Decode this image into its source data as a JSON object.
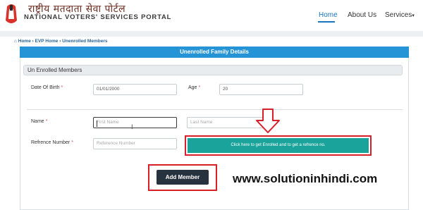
{
  "header": {
    "logo_hindi": "राष्ट्रीय मतदाता सेवा पोर्टल",
    "logo_english": "NATIONAL VOTERS' SERVICES PORTAL",
    "nav": {
      "home": "Home",
      "about": "About Us",
      "services": "Services",
      "services_caret": "▾"
    }
  },
  "breadcrumb": {
    "home_icon": "home-icon",
    "items": [
      "Home",
      "EVP Home",
      "Unenrolled Members"
    ],
    "separator": "›"
  },
  "panel": {
    "title": "Unenrolled Family Details",
    "section_title": "Un Enrolled Members"
  },
  "form": {
    "dob_label": "Date Of Birth",
    "dob_value": "01/01/2000",
    "age_label": "Age",
    "age_value": "20",
    "required_mark": "*",
    "name_label": "Name",
    "first_name_placeholder": "First Name",
    "last_name_placeholder": "Last Name",
    "reference_label": "Refrence Number",
    "reference_placeholder": "Reference Number",
    "enroll_button": "Click here to get Enrolled and to get a refrence no.",
    "add_member_button": "Add Member"
  },
  "watermark": "www.solutioninhindi.com",
  "colors": {
    "accent": "#2494d6",
    "enroll_button": "#1aa39a",
    "add_button": "#27323f",
    "highlight": "#d9202a"
  }
}
